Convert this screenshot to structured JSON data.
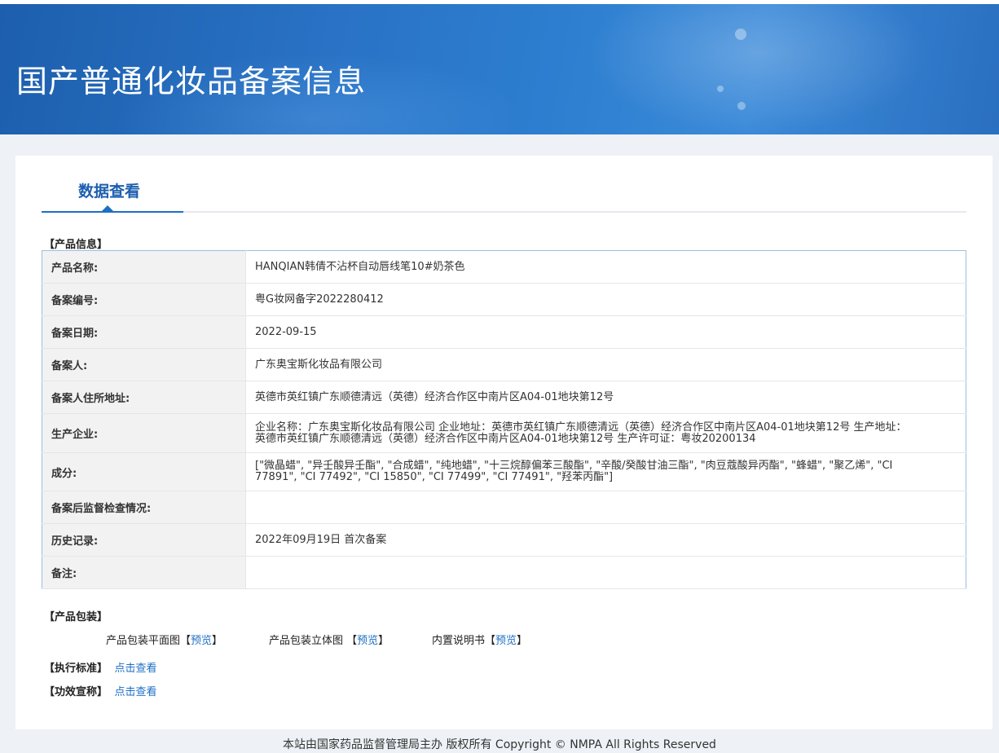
{
  "header": {
    "title": "国产普通化妆品备案信息"
  },
  "tabs": [
    {
      "label": "数据查看",
      "active": true
    }
  ],
  "product_info": {
    "section_label": "【产品信息】",
    "rows": [
      {
        "label": "产品名称:",
        "value": "HANQIAN韩倩不沾杯自动唇线笔10#奶茶色"
      },
      {
        "label": "备案编号:",
        "value": "粤G妆网备字2022280412"
      },
      {
        "label": "备案日期:",
        "value": "2022-09-15"
      },
      {
        "label": "备案人:",
        "value": "广东奥宝斯化妆品有限公司"
      },
      {
        "label": "备案人住所地址:",
        "value": "英德市英红镇广东顺德清远（英德）经济合作区中南片区A04-01地块第12号"
      },
      {
        "label": "生产企业:",
        "value": "企业名称：广东奥宝斯化妆品有限公司 企业地址：英德市英红镇广东顺德清远（英德）经济合作区中南片区A04-01地块第12号 生产地址：英德市英红镇广东顺德清远（英德）经济合作区中南片区A04-01地块第12号 生产许可证：粤妆20200134"
      },
      {
        "label": "成分:",
        "value": "[\"微晶蜡\", \"异壬酸异壬酯\", \"合成蜡\", \"纯地蜡\", \"十三烷醇偏苯三酸酯\", \"辛酸/癸酸甘油三酯\", \"肉豆蔻酸异丙酯\", \"蜂蜡\", \"聚乙烯\", \"CI 77891\", \"CI 77492\", \"CI 15850\", \"CI 77499\", \"CI 77491\", \"羟苯丙酯\"]"
      },
      {
        "label": "备案后监督检查情况:",
        "value": ""
      },
      {
        "label": "历史记录:",
        "value": "2022年09月19日 首次备案"
      },
      {
        "label": "备注:",
        "value": ""
      }
    ]
  },
  "packaging": {
    "section_label": "【产品包装】",
    "items": [
      {
        "name": "产品包装平面图",
        "open": "【",
        "link": "预览",
        "close": "】"
      },
      {
        "name": "产品包装立体图 ",
        "open": "【",
        "link": "预览",
        "close": "】"
      },
      {
        "name": "内置说明书",
        "open": "【",
        "link": "预览",
        "close": "】"
      }
    ]
  },
  "standard": {
    "label": "【执行标准】",
    "link": "点击查看"
  },
  "efficacy": {
    "label": "【功效宣称】",
    "link": "点击查看"
  },
  "footer": {
    "text": "本站由国家药品监督管理局主办 版权所有 Copyright © NMPA All Rights Reserved"
  }
}
